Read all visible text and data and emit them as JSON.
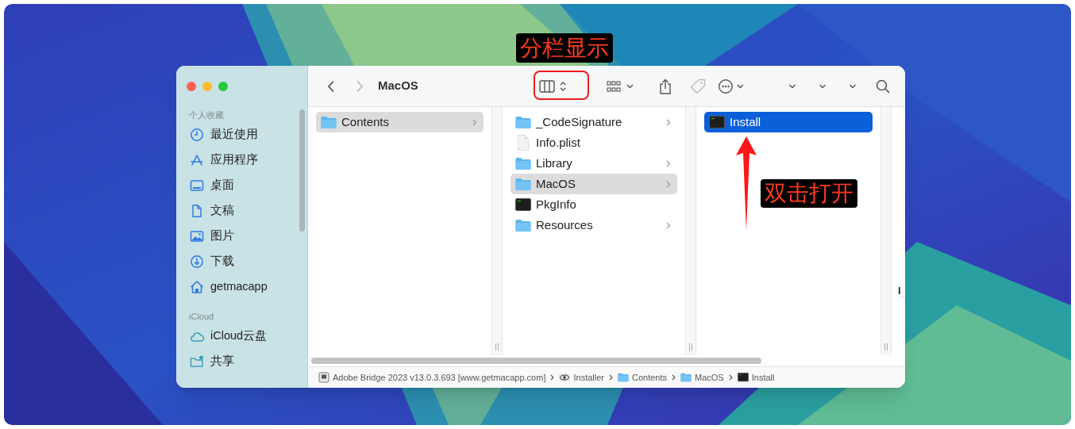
{
  "window": {
    "title": "MacOS",
    "back_enabled": true,
    "forward_enabled": false
  },
  "sidebar": {
    "sections": [
      {
        "header": "个人收藏",
        "items": [
          {
            "label": "最近使用",
            "kind": "recents"
          },
          {
            "label": "应用程序",
            "kind": "apps"
          },
          {
            "label": "桌面",
            "kind": "desktop"
          },
          {
            "label": "文稿",
            "kind": "documents"
          },
          {
            "label": "图片",
            "kind": "pictures"
          },
          {
            "label": "下载",
            "kind": "downloads"
          },
          {
            "label": "getmacapp",
            "kind": "home"
          }
        ]
      },
      {
        "header": "iCloud",
        "items": [
          {
            "label": "iCloud云盘",
            "kind": "cloud"
          },
          {
            "label": "共享",
            "kind": "shared"
          }
        ]
      }
    ]
  },
  "columns": [
    {
      "focused": false,
      "items": [
        {
          "name": "Contents",
          "kind": "folder",
          "has_children": true,
          "selected": true
        }
      ]
    },
    {
      "focused": false,
      "items": [
        {
          "name": "_CodeSignature",
          "kind": "folder",
          "has_children": true,
          "selected": false
        },
        {
          "name": "Info.plist",
          "kind": "file",
          "has_children": false,
          "selected": false
        },
        {
          "name": "Library",
          "kind": "folder",
          "has_children": true,
          "selected": false
        },
        {
          "name": "MacOS",
          "kind": "folder",
          "has_children": true,
          "selected": true
        },
        {
          "name": "PkgInfo",
          "kind": "exec",
          "has_children": false,
          "selected": false
        },
        {
          "name": "Resources",
          "kind": "folder",
          "has_children": true,
          "selected": false
        }
      ]
    },
    {
      "focused": true,
      "items": [
        {
          "name": "Install",
          "kind": "exec",
          "has_children": false,
          "selected": true
        }
      ]
    }
  ],
  "preview": {
    "text": "I"
  },
  "path_bar": [
    {
      "label": "Adobe Bridge 2023 v13.0.3.693 [www.getmacapp.com]",
      "kind": "disk"
    },
    {
      "label": "Installer",
      "kind": "app"
    },
    {
      "label": "Contents",
      "kind": "folder"
    },
    {
      "label": "MacOS",
      "kind": "folder"
    },
    {
      "label": "Install",
      "kind": "exec"
    }
  ],
  "annotations": [
    {
      "text": "分栏显示"
    },
    {
      "text": "双击打开"
    }
  ]
}
